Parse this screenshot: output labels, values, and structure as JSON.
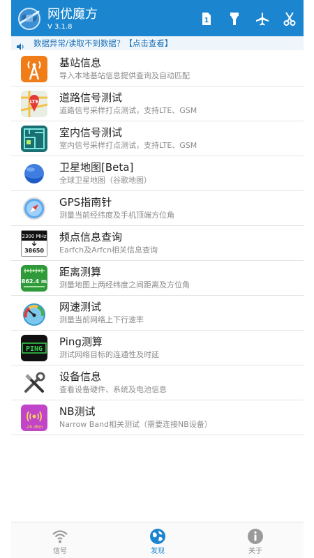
{
  "app": {
    "title": "网优魔方",
    "version": "V 3.1.8"
  },
  "header_icons": [
    "sim-card-1-icon",
    "flashlight-icon",
    "airplane-icon",
    "scissors-icon"
  ],
  "notice": {
    "text": "数据异常/读取不到数据？【点击查看】"
  },
  "menu": [
    {
      "title": "基站信息",
      "subtitle": "导入本地基站信息提供查询及自动匹配",
      "icon": "base-station-icon"
    },
    {
      "title": "道路信号测试",
      "subtitle": "道路信号采样打点测试，支持LTE、GSM",
      "icon": "lte-map-icon",
      "icon_text": "LTE"
    },
    {
      "title": "室内信号测试",
      "subtitle": "室内信号采样打点测试，支持LTE、GSM",
      "icon": "floor-plan-icon"
    },
    {
      "title": "卫星地图[Beta]",
      "subtitle": "全球卫星地图（谷歌地图）",
      "icon": "earth-icon"
    },
    {
      "title": "GPS指南针",
      "subtitle": "测量当前经纬度及手机顶端方位角",
      "icon": "compass-icon"
    },
    {
      "title": "频点信息查询",
      "subtitle": "Earfch及Arfcn相关信息查询",
      "icon": "frequency-icon",
      "icon_text_top": "2300 MHz",
      "icon_text_bottom": "38650"
    },
    {
      "title": "距离测算",
      "subtitle": "测量地图上两经纬度之间距离及方位角",
      "icon": "distance-icon",
      "icon_text": "862.4 m"
    },
    {
      "title": "网速测试",
      "subtitle": "测量当前网络上下行速率",
      "icon": "speedometer-icon"
    },
    {
      "title": "Ping测算",
      "subtitle": "测试网络目标的连通性及时延",
      "icon": "ping-icon",
      "icon_text": "PING"
    },
    {
      "title": "设备信息",
      "subtitle": "查看设备硬件、系统及电池信息",
      "icon": "tools-icon"
    },
    {
      "title": "NB测试",
      "subtitle": "Narrow Band相关测试（需要连接NB设备）",
      "icon": "nb-signal-icon",
      "icon_text": "-26 dBm"
    }
  ],
  "bottom_nav": [
    {
      "label": "信号",
      "icon": "wifi-signal-icon",
      "active": false
    },
    {
      "label": "发现",
      "icon": "globe-icon",
      "active": true
    },
    {
      "label": "关于",
      "icon": "info-icon",
      "active": false
    }
  ],
  "colors": {
    "header": "#1b86cf",
    "accent": "#1b86cf",
    "text": "#222222",
    "subtext": "#8c8c8c"
  }
}
